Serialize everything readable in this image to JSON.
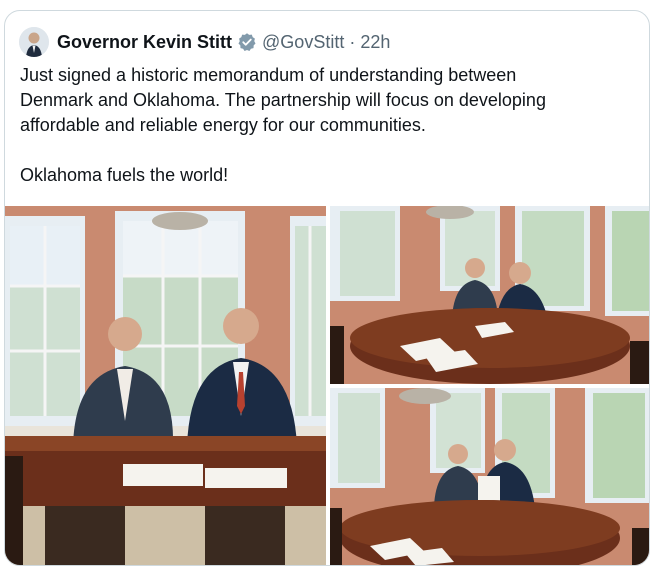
{
  "tweet": {
    "author_name": "Governor Kevin Stitt",
    "handle": "@GovStitt",
    "separator": "·",
    "time": "22h",
    "text_lines": [
      "Just signed a historic memorandum of understanding between",
      "Denmark and Oklahoma. The partnership will focus on developing",
      "affordable and reliable energy for our communities.",
      "Oklahoma fuels the world!"
    ]
  },
  "icons": {
    "verified": "verified-badge-icon"
  },
  "colors": {
    "text_primary": "#0f1419",
    "text_secondary": "#536471",
    "border": "#cfd9de",
    "verified_badge": "#829aab"
  },
  "media": [
    {
      "name": "photo-two-officials-seated-at-table"
    },
    {
      "name": "photo-officials-signing-wide-view"
    },
    {
      "name": "photo-officials-holding-signed-document"
    }
  ]
}
